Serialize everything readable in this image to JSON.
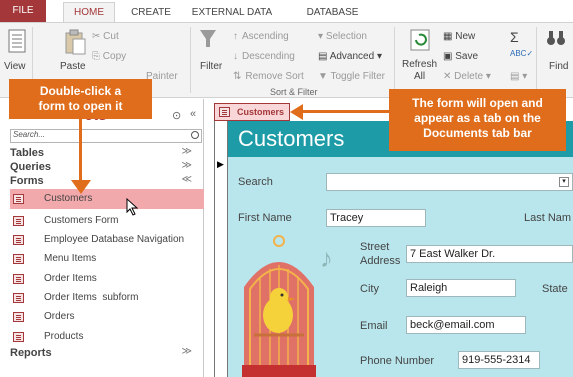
{
  "menu": {
    "file": "FILE",
    "home": "HOME",
    "create": "CREATE",
    "external": "EXTERNAL DATA",
    "dbtools": "DATABASE TOOLS"
  },
  "ribbon": {
    "view": "View",
    "paste": "Paste",
    "cut": "Cut",
    "copy": "Copy",
    "painter": "Painter",
    "filter": "Filter",
    "ascending": "Ascending",
    "descending": "Descending",
    "remove_sort": "Remove Sort",
    "selection": "Selection",
    "advanced": "Advanced",
    "toggle_filter": "Toggle Filter",
    "sort_filter_label": "Sort & Filter",
    "refresh": "Refresh",
    "refresh_all": "All",
    "new": "New",
    "save": "Save",
    "delete": "Delete",
    "find": "Find"
  },
  "nav": {
    "title_partial": "cts",
    "search_placeholder": "Search...",
    "categories": [
      "Tables",
      "Queries",
      "Forms",
      "Reports"
    ],
    "forms": [
      "Customers",
      "Customers Form",
      "Employee Database Navigation",
      "Menu Items",
      "Order Items",
      "Order Items  subform",
      "Orders",
      "Products"
    ]
  },
  "doc": {
    "tab_label": "Customers",
    "header": "Customers",
    "fields": {
      "search": "Search",
      "first_name": "First Name",
      "first_name_value": "Tracey",
      "last_name": "Last Nam",
      "street": "Street",
      "address": "Address",
      "street_value": "7 East Walker Dr.",
      "city": "City",
      "city_value": "Raleigh",
      "state": "State",
      "email": "Email",
      "email_value": "beck@email.com",
      "phone": "Phone Number",
      "phone_value": "919-555-2314"
    }
  },
  "callouts": {
    "left_1": "Double-click a",
    "left_2": "form to open it",
    "right_1": "The form will open and",
    "right_2": "appear as a tab on the",
    "right_3": "Documents tab bar"
  },
  "colors": {
    "accent": "#a4373a",
    "callout": "#e06d1b",
    "teal": "#1d9ba7",
    "form_bg": "#b9e6ec",
    "selected": "#f2a9ac"
  }
}
